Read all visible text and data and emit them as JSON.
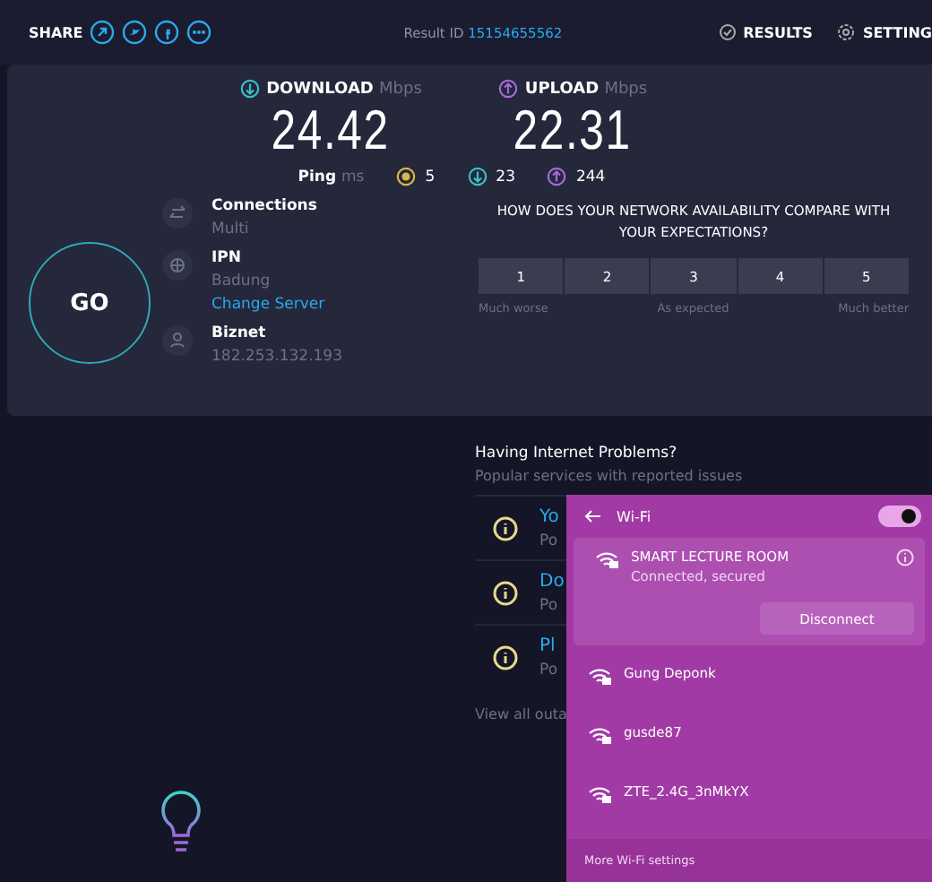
{
  "top_bar": {
    "share_label": "SHARE",
    "result_label": "Result ID",
    "result_id": "15154655562",
    "links": [
      {
        "kind": "results",
        "label": "RESULTS"
      },
      {
        "kind": "settings",
        "label": "SETTING"
      }
    ]
  },
  "speeds": [
    {
      "kind": "download",
      "label": "DOWNLOAD",
      "unit": "Mbps",
      "value": "24.42"
    },
    {
      "kind": "upload",
      "label": "UPLOAD",
      "unit": "Mbps",
      "value": "22.31"
    }
  ],
  "ping": {
    "label": "Ping",
    "unit": "ms",
    "readings": [
      {
        "kind": "idle",
        "value": "5"
      },
      {
        "kind": "download",
        "value": "23"
      },
      {
        "kind": "upload",
        "value": "244"
      }
    ]
  },
  "go_button": "GO",
  "server_info": [
    {
      "kind": "connections",
      "title": "Connections",
      "lines": [
        "Multi"
      ]
    },
    {
      "kind": "server",
      "title": "IPN",
      "lines": [
        "Badung"
      ],
      "link": "Change Server"
    },
    {
      "kind": "provider",
      "title": "Biznet",
      "lines": [
        "182.253.132.193"
      ]
    }
  ],
  "survey": {
    "question": "HOW DOES YOUR NETWORK AVAILABILITY COMPARE WITH YOUR EXPECTATIONS?",
    "options": [
      "1",
      "2",
      "3",
      "4",
      "5"
    ],
    "scale": [
      "Much worse",
      "As expected",
      "Much better"
    ]
  },
  "problems": {
    "title": "Having Internet Problems?",
    "subtitle": "Popular services with reported issues",
    "services": [
      {
        "name": "Yo",
        "note": "Po"
      },
      {
        "name": "Do",
        "note": "Po"
      },
      {
        "name": "Pl",
        "note": "Po"
      }
    ],
    "view_all": "View all outa"
  },
  "wifi_panel": {
    "title": "Wi-Fi",
    "on": true,
    "networks": [
      {
        "name": "SMART LECTURE ROOM",
        "status": "Connected, secured",
        "connected": true,
        "action": "Disconnect"
      },
      {
        "name": "Gung Deponk",
        "connected": false
      },
      {
        "name": "gusde87",
        "connected": false
      },
      {
        "name": "ZTE_2.4G_3nMkYX",
        "connected": false
      }
    ],
    "footer": "More Wi-Fi settings"
  }
}
